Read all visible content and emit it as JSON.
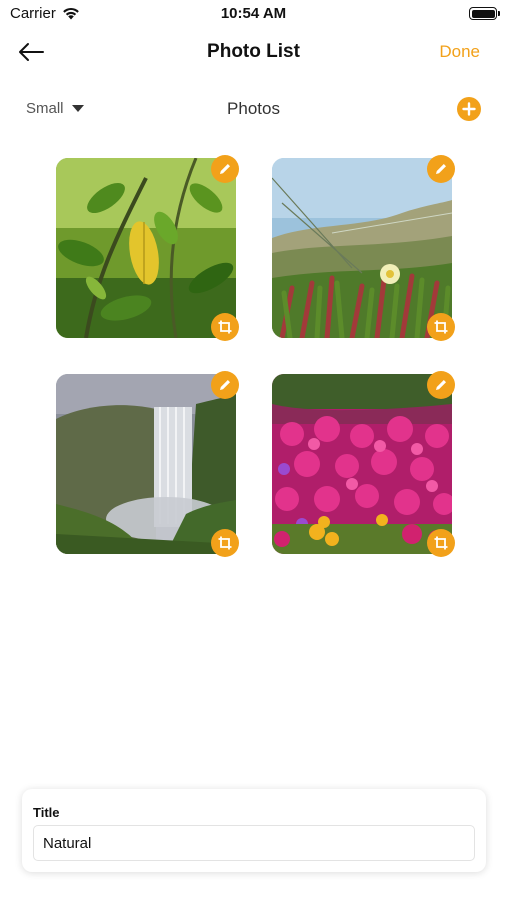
{
  "status_bar": {
    "carrier": "Carrier",
    "time": "10:54 AM"
  },
  "nav": {
    "title": "Photo List",
    "done_label": "Done",
    "back_icon": "arrow-left-icon"
  },
  "toolbar": {
    "size_label": "Small",
    "section_title": "Photos",
    "add_icon": "plus-circle-icon"
  },
  "photos": [
    {
      "subject": "green leaves",
      "edit_icon": "pencil-icon",
      "crop_icon": "crop-icon"
    },
    {
      "subject": "dune plants with yellow flower",
      "edit_icon": "pencil-icon",
      "crop_icon": "crop-icon"
    },
    {
      "subject": "waterfall",
      "edit_icon": "pencil-icon",
      "crop_icon": "crop-icon"
    },
    {
      "subject": "pink flowers",
      "edit_icon": "pencil-icon",
      "crop_icon": "crop-icon"
    }
  ],
  "form": {
    "title_label": "Title",
    "title_value": "Natural"
  },
  "colors": {
    "accent": "#f2a11a"
  }
}
